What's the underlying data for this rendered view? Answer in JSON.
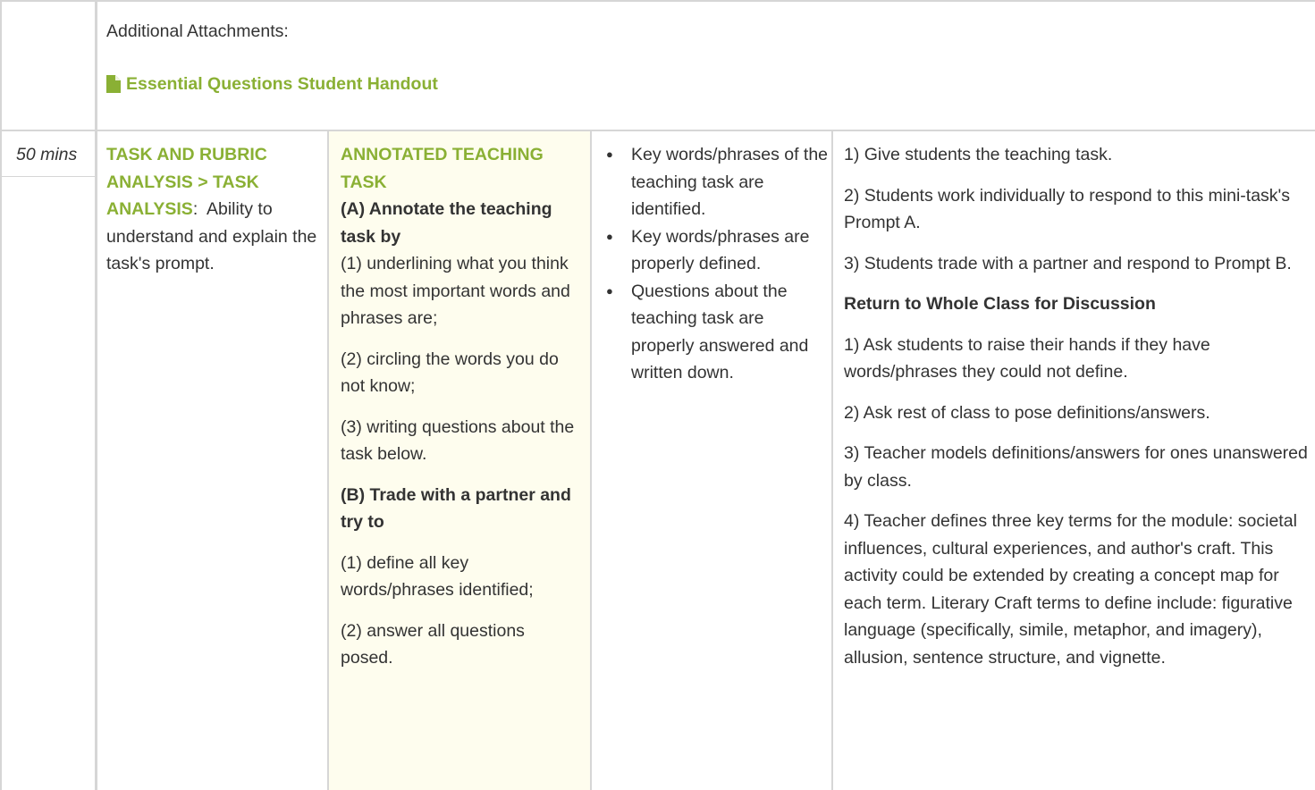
{
  "attachments": {
    "label": "Additional Attachments:",
    "link_text": "Essential Questions Student Handout",
    "icon": "file-icon"
  },
  "row": {
    "time": "50 mins",
    "skill": {
      "title": "TASK AND RUBRIC ANALYSIS > TASK ANALYSIS",
      "separator": ":",
      "description": "Ability to understand and explain the task's prompt."
    },
    "product": {
      "title": "ANNOTATED TEACHING TASK",
      "part_a_heading": "(A) Annotate the teaching task by",
      "part_a_items": [
        "(1) underlining what you think the most important words and phrases are;",
        "(2) circling the words you do not know;",
        "(3) writing questions about the task below."
      ],
      "part_b_heading": "(B) Trade with a partner and try to",
      "part_b_items": [
        "(1) define all key words/phrases identified;",
        "(2) answer all questions posed."
      ]
    },
    "scoring": [
      "Key words/phrases of the teaching task are identified.",
      "Key words/phrases are properly defined.",
      "Questions about the teaching task are properly answered and written down."
    ],
    "instruction": {
      "steps": [
        "1) Give students the teaching task.",
        "2) Students work individually to respond to this mini-task's Prompt A.",
        "3) Students trade with a partner and respond to Prompt B."
      ],
      "discussion_heading": "Return to Whole Class for Discussion",
      "discussion_steps": [
        "1) Ask students to raise their hands if they have words/phrases they could not define.",
        "2) Ask rest of class to pose definitions/answers.",
        "3) Teacher models definitions/answers for ones unanswered by class.",
        "4) Teacher defines three key terms for the module: societal influences, cultural experiences, and author's craft. This activity could be extended by creating a concept map for each term. Literary Craft terms to define include: figurative language (specifically, simile, metaphor, and imagery), allusion, sentence structure, and vignette."
      ]
    }
  },
  "colors": {
    "accent_green": "#8ab034",
    "highlight_bg": "#fefdee",
    "border": "#d6d6d6",
    "text": "#333333"
  }
}
